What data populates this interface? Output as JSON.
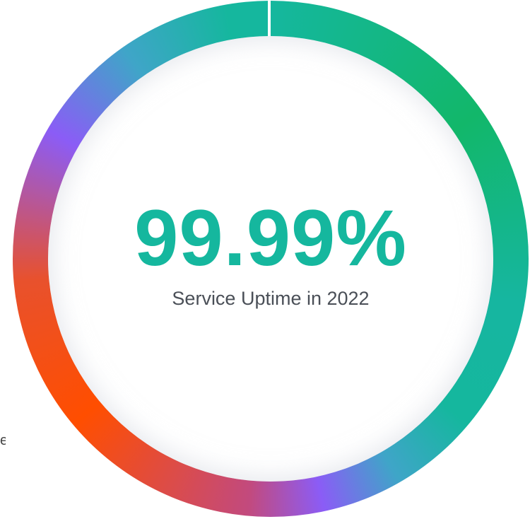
{
  "stat": {
    "value": "99.99%",
    "label": "Service Uptime in 2022",
    "fraction": 0.9999
  },
  "edge_text": "e",
  "colors": {
    "value_text": "#15b79e",
    "label_text": "#4a4f57",
    "ring_gradient": [
      "#15b79e",
      "#12b76a",
      "#15b79e",
      "#8b5cf6",
      "#ff4e00",
      "#8b5cf6",
      "#15b79e"
    ]
  }
}
